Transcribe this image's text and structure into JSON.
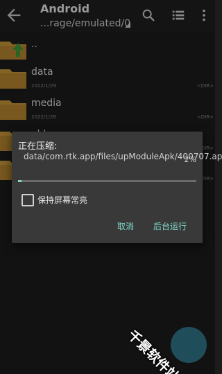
{
  "toolbar": {
    "title": "Android",
    "path": "...rage/emulated/0",
    "icons": [
      "back-arrow-icon",
      "search-icon",
      "list-view-icon",
      "more-vert-icon"
    ]
  },
  "files": [
    {
      "name": "..",
      "date": "",
      "tag": "",
      "icon": "parent-folder-icon"
    },
    {
      "name": "data",
      "date": "2022/1/29",
      "tag": "<DIR>",
      "icon": "folder-icon"
    },
    {
      "name": "media",
      "date": "2022/1/26",
      "tag": "<DIR>",
      "icon": "folder-icon"
    },
    {
      "name": "obb",
      "date": "",
      "tag": "<DIR>",
      "icon": "folder-icon"
    },
    {
      "name": "",
      "date": "",
      "tag": "<DIR>",
      "icon": "folder-icon"
    }
  ],
  "dialog": {
    "title": "正在压缩:",
    "file": "data/com.rtk.app/files/upModuleApk/400707.apk",
    "percent": "2%",
    "progress": 0.02,
    "checkbox_label": "保持屏幕常亮",
    "cancel": "取消",
    "background": "后台运行"
  },
  "watermark": {
    "text": "千景软件站"
  },
  "colors": {
    "accent": "#7fd8c9",
    "folder": "#c99a3a",
    "arrow": "#3f9a3a"
  }
}
